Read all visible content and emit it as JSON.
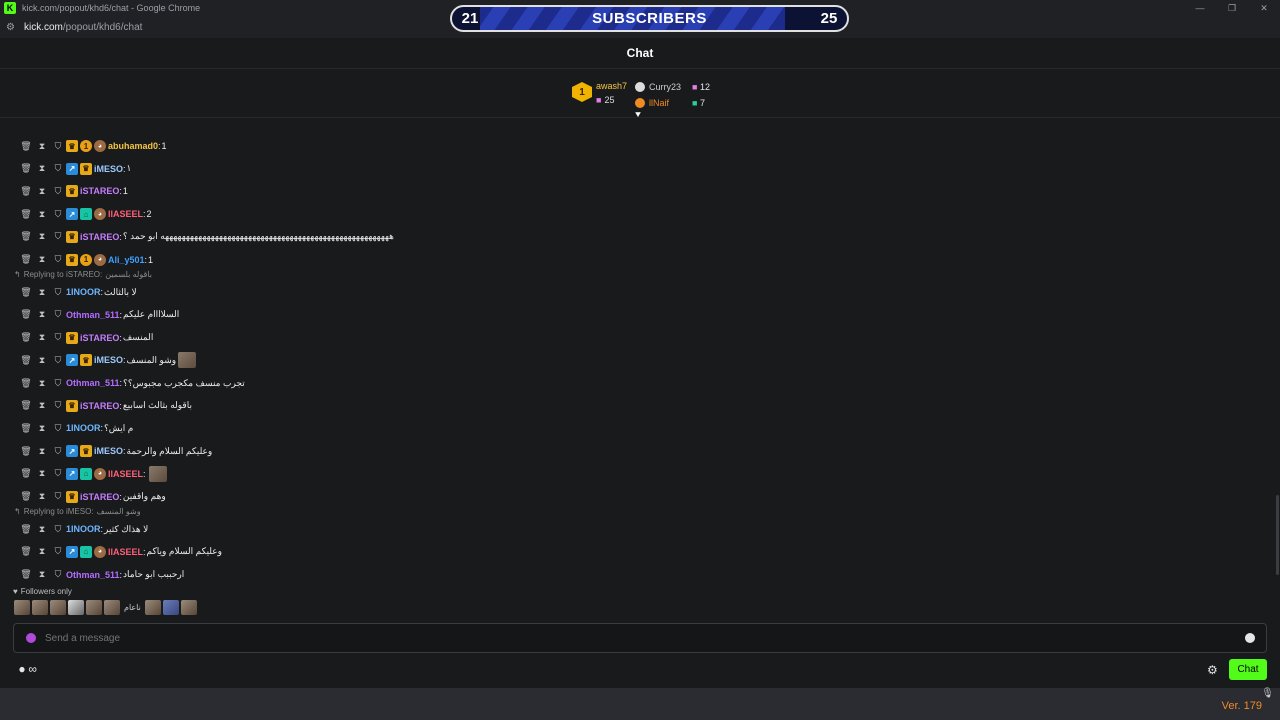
{
  "browser": {
    "tab_title": "kick.com/popout/khd6/chat - Google Chrome",
    "address_domain": "kick.com",
    "address_path": "/popout/khd6/chat"
  },
  "subgoal": {
    "left": "21",
    "label": "SUBSCRIBERS",
    "right": "25",
    "progress_fraction": 0.84
  },
  "header": {
    "title": "Chat"
  },
  "leaderboard": {
    "top": {
      "rank": "1",
      "name": "awash7",
      "gifts": "25"
    },
    "others": [
      {
        "name": "Curry23",
        "gifts": "12",
        "name_color": "#cfcfcf",
        "icon_color": "#dcdcdc"
      },
      {
        "name": "llNaif",
        "gifts": "7",
        "name_color": "#f08a24",
        "icon_color": "#f08a24"
      }
    ]
  },
  "messages": [
    {
      "user": "abuhamad0",
      "text": "1",
      "color": "#f5c542",
      "badges": [
        "crown",
        "medal",
        "ava"
      ]
    },
    {
      "user": "iMESO",
      "text": "١",
      "color": "#9fc9ff",
      "badges": [
        "arrow",
        "crown"
      ]
    },
    {
      "user": "iSTAREO",
      "text": "1",
      "color": "#c77dff",
      "badges": [
        "crown"
      ]
    },
    {
      "user": "llASEEL",
      "text": "2",
      "color": "#ff5f77",
      "badges": [
        "arrow",
        "plug",
        "ava"
      ]
    },
    {
      "user": "iSTAREO",
      "text": "هههههههههههههههههههههههههههههههههههههههههههههههههههههههه ابو حمد ؟",
      "color": "#c77dff",
      "badges": [
        "crown"
      ]
    },
    {
      "user": "Ali_y501",
      "text": "1",
      "color": "#3ea0ff",
      "badges": [
        "crown",
        "medal",
        "ava"
      ]
    },
    {
      "reply_label": "Replying to iSTAREO:",
      "reply_text": "باقوله بلسمين"
    },
    {
      "user": "1INOOR",
      "text": "لا بالثالث",
      "color": "#6fb6ff",
      "badges": []
    },
    {
      "user": "Othman_511",
      "text": "السلاااام عليكم",
      "color": "#b46dff",
      "badges": []
    },
    {
      "user": "iSTAREO",
      "text": "المنسف",
      "color": "#c77dff",
      "badges": [
        "crown"
      ]
    },
    {
      "user": "iMESO",
      "text": "وشو المنسف",
      "color": "#9fc9ff",
      "badges": [
        "arrow",
        "crown"
      ],
      "emote": true
    },
    {
      "user": "Othman_511",
      "text": "تجرب منسف مكجرب مجبوس؟؟",
      "color": "#b46dff",
      "badges": []
    },
    {
      "user": "iSTAREO",
      "text": "باقوله بثالث اسابيع",
      "color": "#c77dff",
      "badges": [
        "crown"
      ]
    },
    {
      "user": "1INOOR",
      "text": "م ايش؟",
      "color": "#6fb6ff",
      "badges": []
    },
    {
      "user": "iMESO",
      "text": "وعليكم السلام والرحمة",
      "color": "#9fc9ff",
      "badges": [
        "arrow",
        "crown"
      ]
    },
    {
      "user": "llASEEL",
      "text": "",
      "color": "#ff5f77",
      "badges": [
        "arrow",
        "plug",
        "ava"
      ],
      "emote": true
    },
    {
      "user": "iSTAREO",
      "text": "وهم واقفين",
      "color": "#c77dff",
      "badges": [
        "crown"
      ]
    },
    {
      "reply_label": "Replying to iMESO:",
      "reply_text": "وشو المنسف"
    },
    {
      "user": "1INOOR",
      "text": "لا هذاك كثير",
      "color": "#6fb6ff",
      "badges": []
    },
    {
      "user": "llASEEL",
      "text": "وعليكم السلام وياكم",
      "color": "#ff5f77",
      "badges": [
        "arrow",
        "plug",
        "ava"
      ]
    },
    {
      "user": "Othman_511",
      "text": "ارحببب ابو حاماد",
      "color": "#b46dff",
      "badges": []
    }
  ],
  "footer": {
    "followers_only": "Followers only",
    "emote_text": "ناعام",
    "input_placeholder": "Send a message",
    "chat_button": "Chat"
  },
  "version": "Ver. 179",
  "colors": {
    "kick_green": "#53fc18",
    "bg": "#181a1c"
  },
  "icons": [
    "delete-icon",
    "timeout-icon",
    "shield-icon",
    "crown-badge-icon",
    "gear-icon",
    "emoji-icon",
    "mic-icon"
  ]
}
